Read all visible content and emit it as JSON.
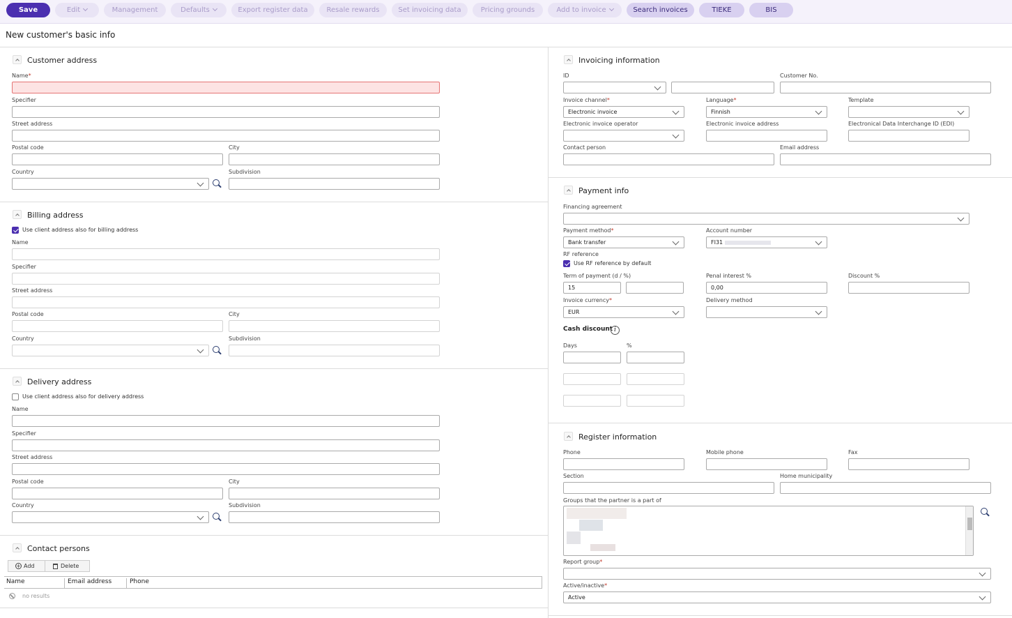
{
  "toolbar": {
    "save": "Save",
    "edit": "Edit",
    "management": "Management",
    "defaults": "Defaults",
    "export_register": "Export register data",
    "resale_rewards": "Resale rewards",
    "set_invoicing": "Set invoicing data",
    "pricing_grounds": "Pricing grounds",
    "add_to_invoice": "Add to invoice",
    "search_invoices": "Search invoices",
    "tieke": "TIEKE",
    "bis": "BIS"
  },
  "page_title": "New customer's basic info",
  "customer_address": {
    "title": "Customer address",
    "name": "Name",
    "specifier": "Specifier",
    "street": "Street address",
    "postal": "Postal code",
    "city": "City",
    "country": "Country",
    "subdivision": "Subdivision"
  },
  "billing_address": {
    "title": "Billing address",
    "use_client": "Use client address also for billing address",
    "name": "Name",
    "specifier": "Specifier",
    "street": "Street address",
    "postal": "Postal code",
    "city": "City",
    "country": "Country",
    "subdivision": "Subdivision"
  },
  "delivery_address": {
    "title": "Delivery address",
    "use_client": "Use client address also for delivery address",
    "name": "Name",
    "specifier": "Specifier",
    "street": "Street address",
    "postal": "Postal code",
    "city": "City",
    "country": "Country",
    "subdivision": "Subdivision"
  },
  "contact_persons": {
    "title": "Contact persons",
    "add": "Add",
    "delete": "Delete",
    "columns": [
      "Name",
      "Email address",
      "Phone"
    ],
    "no_results": "no results"
  },
  "invoicing": {
    "title": "Invoicing information",
    "id": "ID",
    "customer_no": "Customer No.",
    "channel": "Invoice channel",
    "channel_value": "Electronic invoice",
    "language": "Language",
    "language_value": "Finnish",
    "template": "Template",
    "operator": "Electronic invoice operator",
    "einvoice_address": "Electronic invoice address",
    "edi": "Electronical Data Interchange ID (EDI)",
    "contact_person": "Contact person",
    "email": "Email address"
  },
  "payment": {
    "title": "Payment info",
    "financing": "Financing agreement",
    "method": "Payment method",
    "method_value": "Bank transfer",
    "account": "Account number",
    "account_value": "FI31",
    "rf_reference": "RF reference",
    "use_rf": "Use RF reference by default",
    "term": "Term of payment (d / %)",
    "term_value": "15",
    "penal": "Penal interest %",
    "penal_value": "0,00",
    "discount": "Discount %",
    "currency": "Invoice currency",
    "currency_value": "EUR",
    "delivery_method": "Delivery method",
    "cash_discount": "Cash discount",
    "days": "Days",
    "percent": "%"
  },
  "register": {
    "title": "Register information",
    "phone": "Phone",
    "mobile": "Mobile phone",
    "fax": "Fax",
    "section": "Section",
    "home_municipality": "Home municipality",
    "groups": "Groups that the partner is a part of",
    "report_group": "Report group",
    "active_inactive": "Active/inactive",
    "active_value": "Active"
  },
  "colors": {
    "primary": "#4b2fb0",
    "toolbar_bg": "#f5f2fb",
    "error_bg": "#fde3e3"
  }
}
